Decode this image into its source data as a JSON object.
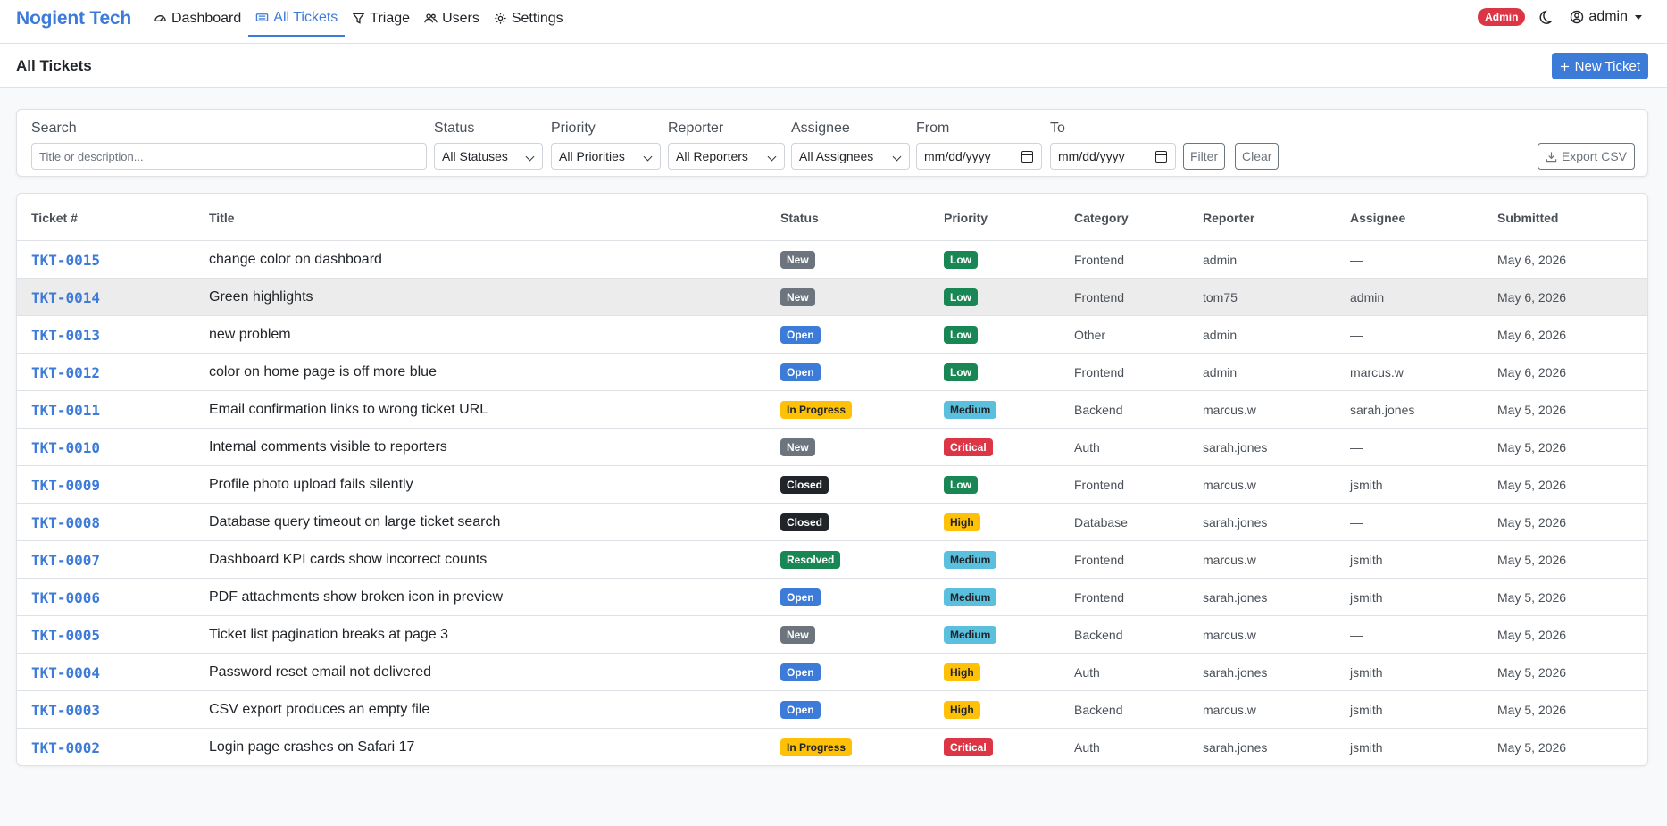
{
  "nav": {
    "brand": "Nogient Tech",
    "items": [
      {
        "label": "Dashboard",
        "icon": "gauge-icon",
        "active": false
      },
      {
        "label": "All Tickets",
        "icon": "ticket-icon",
        "active": true
      },
      {
        "label": "Triage",
        "icon": "funnel-icon",
        "active": false
      },
      {
        "label": "Users",
        "icon": "users-icon",
        "active": false
      },
      {
        "label": "Settings",
        "icon": "gear-icon",
        "active": false
      }
    ],
    "role_badge": "Admin",
    "user": "admin"
  },
  "header": {
    "title": "All Tickets",
    "new_button": "New Ticket"
  },
  "filters": {
    "search_label": "Search",
    "search_placeholder": "Title or description...",
    "status_label": "Status",
    "status_value": "All Statuses",
    "priority_label": "Priority",
    "priority_value": "All Priorities",
    "reporter_label": "Reporter",
    "reporter_value": "All Reporters",
    "assignee_label": "Assignee",
    "assignee_value": "All Assignees",
    "from_label": "From",
    "from_placeholder": "mm/dd/yyyy",
    "to_label": "To",
    "to_placeholder": "mm/dd/yyyy",
    "filter_button": "Filter",
    "clear_button": "Clear",
    "export_button": "Export CSV"
  },
  "table": {
    "columns": [
      "Ticket #",
      "Title",
      "Status",
      "Priority",
      "Category",
      "Reporter",
      "Assignee",
      "Submitted"
    ],
    "rows": [
      {
        "id": "TKT-0015",
        "title": "change color on dashboard",
        "status": "New",
        "priority": "Low",
        "category": "Frontend",
        "reporter": "admin",
        "assignee": "—",
        "submitted": "May 6, 2026"
      },
      {
        "id": "TKT-0014",
        "title": "Green highlights",
        "status": "New",
        "priority": "Low",
        "category": "Frontend",
        "reporter": "tom75",
        "assignee": "admin",
        "submitted": "May 6, 2026"
      },
      {
        "id": "TKT-0013",
        "title": "new problem",
        "status": "Open",
        "priority": "Low",
        "category": "Other",
        "reporter": "admin",
        "assignee": "—",
        "submitted": "May 6, 2026"
      },
      {
        "id": "TKT-0012",
        "title": "color on home page is off more blue",
        "status": "Open",
        "priority": "Low",
        "category": "Frontend",
        "reporter": "admin",
        "assignee": "marcus.w",
        "submitted": "May 6, 2026"
      },
      {
        "id": "TKT-0011",
        "title": "Email confirmation links to wrong ticket URL",
        "status": "In Progress",
        "priority": "Medium",
        "category": "Backend",
        "reporter": "marcus.w",
        "assignee": "sarah.jones",
        "submitted": "May 5, 2026"
      },
      {
        "id": "TKT-0010",
        "title": "Internal comments visible to reporters",
        "status": "New",
        "priority": "Critical",
        "category": "Auth",
        "reporter": "sarah.jones",
        "assignee": "—",
        "submitted": "May 5, 2026"
      },
      {
        "id": "TKT-0009",
        "title": "Profile photo upload fails silently",
        "status": "Closed",
        "priority": "Low",
        "category": "Frontend",
        "reporter": "marcus.w",
        "assignee": "jsmith",
        "submitted": "May 5, 2026"
      },
      {
        "id": "TKT-0008",
        "title": "Database query timeout on large ticket search",
        "status": "Closed",
        "priority": "High",
        "category": "Database",
        "reporter": "sarah.jones",
        "assignee": "—",
        "submitted": "May 5, 2026"
      },
      {
        "id": "TKT-0007",
        "title": "Dashboard KPI cards show incorrect counts",
        "status": "Resolved",
        "priority": "Medium",
        "category": "Frontend",
        "reporter": "marcus.w",
        "assignee": "jsmith",
        "submitted": "May 5, 2026"
      },
      {
        "id": "TKT-0006",
        "title": "PDF attachments show broken icon in preview",
        "status": "Open",
        "priority": "Medium",
        "category": "Frontend",
        "reporter": "sarah.jones",
        "assignee": "jsmith",
        "submitted": "May 5, 2026"
      },
      {
        "id": "TKT-0005",
        "title": "Ticket list pagination breaks at page 3",
        "status": "New",
        "priority": "Medium",
        "category": "Backend",
        "reporter": "marcus.w",
        "assignee": "—",
        "submitted": "May 5, 2026"
      },
      {
        "id": "TKT-0004",
        "title": "Password reset email not delivered",
        "status": "Open",
        "priority": "High",
        "category": "Auth",
        "reporter": "sarah.jones",
        "assignee": "jsmith",
        "submitted": "May 5, 2026"
      },
      {
        "id": "TKT-0003",
        "title": "CSV export produces an empty file",
        "status": "Open",
        "priority": "High",
        "category": "Backend",
        "reporter": "marcus.w",
        "assignee": "jsmith",
        "submitted": "May 5, 2026"
      },
      {
        "id": "TKT-0002",
        "title": "Login page crashes on Safari 17",
        "status": "In Progress",
        "priority": "Critical",
        "category": "Auth",
        "reporter": "sarah.jones",
        "assignee": "jsmith",
        "submitted": "May 5, 2026"
      }
    ]
  },
  "badge_colors": {
    "New": {
      "bg": "#6c757d",
      "fg": "#ffffff"
    },
    "Open": {
      "bg": "#3d7bd9",
      "fg": "#ffffff"
    },
    "In Progress": {
      "bg": "#ffc107",
      "fg": "#212529"
    },
    "Closed": {
      "bg": "#212529",
      "fg": "#ffffff"
    },
    "Resolved": {
      "bg": "#198754",
      "fg": "#ffffff"
    },
    "Low": {
      "bg": "#198754",
      "fg": "#ffffff"
    },
    "Medium": {
      "bg": "#5bc0de",
      "fg": "#212529"
    },
    "High": {
      "bg": "#ffc107",
      "fg": "#212529"
    },
    "Critical": {
      "bg": "#dc3545",
      "fg": "#ffffff"
    }
  }
}
